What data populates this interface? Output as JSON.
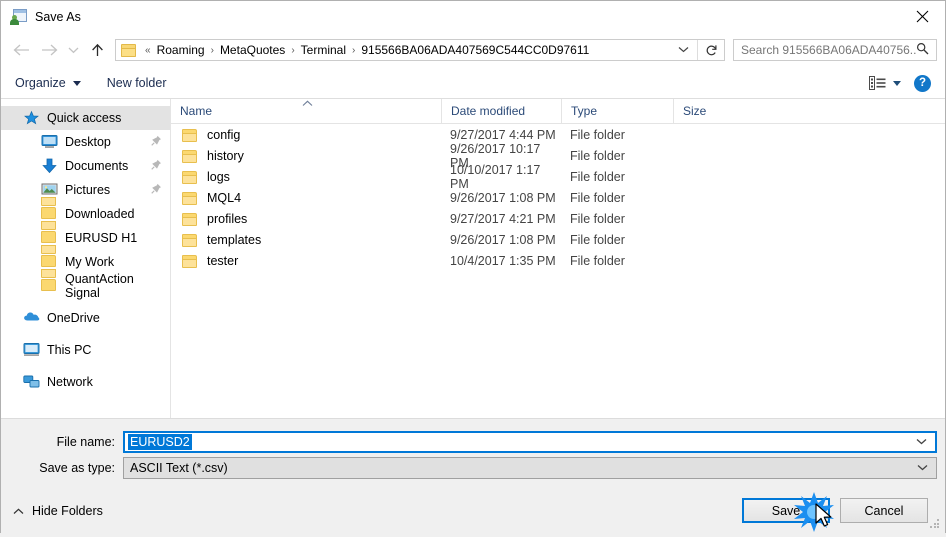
{
  "window": {
    "title": "Save As",
    "icon": "save-as-icon",
    "close_label": "✕"
  },
  "nav": {
    "back": "back-arrow",
    "forward": "forward-arrow",
    "recent": "recent-locations-chevron",
    "up": "up-arrow",
    "breadcrumb_prefix": "«",
    "breadcrumb": [
      "Roaming",
      "MetaQuotes",
      "Terminal",
      "915566BA06ADA407569C544CC0D97611"
    ],
    "breadcrumb_separator": "›",
    "dropdown": "chevron-down",
    "refresh": "refresh-icon"
  },
  "search": {
    "placeholder": "Search 915566BA06ADA40756...",
    "icon": "search-icon"
  },
  "toolbar": {
    "organize": "Organize",
    "new_folder": "New folder",
    "view_icon": "view-layout-icon",
    "view_dropdown": "chevron-down-icon",
    "help": "?"
  },
  "sidebar": {
    "items": [
      {
        "label": "Quick access",
        "icon": "star-icon",
        "level": 0,
        "selected": true,
        "pinned": false
      },
      {
        "label": "Desktop",
        "icon": "desktop-icon",
        "level": 1,
        "selected": false,
        "pinned": true
      },
      {
        "label": "Documents",
        "icon": "documents-down-arrow-icon",
        "level": 1,
        "selected": false,
        "pinned": true
      },
      {
        "label": "Pictures",
        "icon": "pictures-icon",
        "level": 1,
        "selected": false,
        "pinned": true
      },
      {
        "label": "Downloaded",
        "icon": "folder-icon",
        "level": 1,
        "selected": false,
        "pinned": false
      },
      {
        "label": "EURUSD H1",
        "icon": "folder-icon",
        "level": 1,
        "selected": false,
        "pinned": false
      },
      {
        "label": "My Work",
        "icon": "folder-icon",
        "level": 1,
        "selected": false,
        "pinned": false
      },
      {
        "label": "QuantAction Signal",
        "icon": "folder-icon",
        "level": 1,
        "selected": false,
        "pinned": false
      },
      {
        "label": "OneDrive",
        "icon": "onedrive-cloud-icon",
        "level": 0,
        "selected": false,
        "pinned": false
      },
      {
        "label": "This PC",
        "icon": "this-pc-icon",
        "level": 0,
        "selected": false,
        "pinned": false
      },
      {
        "label": "Network",
        "icon": "network-icon",
        "level": 0,
        "selected": false,
        "pinned": false
      }
    ]
  },
  "filelist": {
    "columns": [
      "Name",
      "Date modified",
      "Type",
      "Size"
    ],
    "sort_indicator": "^",
    "rows": [
      {
        "name": "config",
        "date": "9/27/2017 4:44 PM",
        "type": "File folder",
        "size": ""
      },
      {
        "name": "history",
        "date": "9/26/2017 10:17 PM",
        "type": "File folder",
        "size": ""
      },
      {
        "name": "logs",
        "date": "10/10/2017 1:17 PM",
        "type": "File folder",
        "size": ""
      },
      {
        "name": "MQL4",
        "date": "9/26/2017 1:08 PM",
        "type": "File folder",
        "size": ""
      },
      {
        "name": "profiles",
        "date": "9/27/2017 4:21 PM",
        "type": "File folder",
        "size": ""
      },
      {
        "name": "templates",
        "date": "9/26/2017 1:08 PM",
        "type": "File folder",
        "size": ""
      },
      {
        "name": "tester",
        "date": "10/4/2017 1:35 PM",
        "type": "File folder",
        "size": ""
      }
    ]
  },
  "form": {
    "filename_label": "File name:",
    "filename_value": "EURUSD2",
    "filetype_label": "Save as type:",
    "filetype_value": "ASCII Text (*.csv)",
    "chevron": "⌄"
  },
  "footer": {
    "hide_folders": "Hide Folders",
    "hide_folders_caret": "^",
    "save": "Save",
    "cancel": "Cancel"
  },
  "colors": {
    "accent": "#0078d7",
    "folder": "#fbd870",
    "breadcrumb_text": "#000000",
    "header_text": "#2b4a78",
    "help_blue": "#1177c9"
  }
}
